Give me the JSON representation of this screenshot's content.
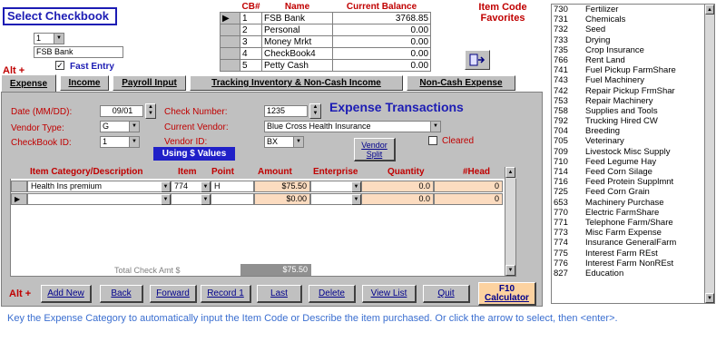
{
  "header": {
    "title": "Select Checkbook",
    "selected_number": "1",
    "selected_name": "FSB Bank",
    "fast_entry_label": "Fast Entry",
    "alt_label": "Alt +"
  },
  "cb_table": {
    "columns": [
      "CB#",
      "Name",
      "Current Balance"
    ],
    "rows": [
      {
        "num": "1",
        "name": "FSB Bank",
        "balance": "3768.85"
      },
      {
        "num": "2",
        "name": "Personal",
        "balance": "0.00"
      },
      {
        "num": "3",
        "name": "Money Mrkt",
        "balance": "0.00"
      },
      {
        "num": "4",
        "name": "CheckBook4",
        "balance": "0.00"
      },
      {
        "num": "5",
        "name": "Petty Cash",
        "balance": "0.00"
      }
    ]
  },
  "favorites": {
    "title_line1": "Item Code",
    "title_line2": "Favorites"
  },
  "tabs": [
    "Expense",
    "Income",
    "Payroll Input",
    "Tracking Inventory & Non-Cash Income",
    "Non-Cash Expense"
  ],
  "form": {
    "section_title": "Expense Transactions",
    "date_label": "Date (MM/DD):",
    "date_value": "09/01",
    "vendor_type_label": "Vendor Type:",
    "vendor_type_value": "G",
    "checkbook_id_label": "CheckBook ID:",
    "checkbook_id_value": "1",
    "check_number_label": "Check Number:",
    "check_number_value": "1235",
    "current_vendor_label": "Current Vendor:",
    "current_vendor_value": "Blue Cross Health Insurance",
    "vendor_id_label": "Vendor ID:",
    "vendor_id_value": "BX",
    "using_values_label": "Using $ Values",
    "vendor_split_label": "Vendor Split",
    "cleared_label": "Cleared"
  },
  "grid": {
    "columns": [
      "Item Category/Description",
      "Item",
      "Point",
      "Amount",
      "Enterprise",
      "Quantity",
      "#Head"
    ],
    "rows": [
      {
        "desc": "Health Ins premium",
        "item": "774",
        "point": "H",
        "amount": "$75.50",
        "enterprise": "",
        "quantity": "0.0",
        "head": "0"
      },
      {
        "desc": "",
        "item": "",
        "point": "",
        "amount": "$0.00",
        "enterprise": "",
        "quantity": "0.0",
        "head": "0"
      }
    ],
    "total_label": "Total Check Amt $",
    "total_value": "$75.50"
  },
  "footer": {
    "alt_label": "Alt +",
    "buttons": [
      "Add New",
      "Back",
      "Forward",
      "Record 1",
      "Last",
      "Delete",
      "View List",
      "Quit"
    ],
    "f10_label": "F10",
    "calculator_label": "Calculator"
  },
  "categories": [
    {
      "code": "730",
      "name": "Fertilizer"
    },
    {
      "code": "731",
      "name": "Chemicals"
    },
    {
      "code": "732",
      "name": "Seed"
    },
    {
      "code": "733",
      "name": "Drying"
    },
    {
      "code": "735",
      "name": "Crop Insurance"
    },
    {
      "code": "766",
      "name": "Rent Land"
    },
    {
      "code": "741",
      "name": "Fuel Pickup FarmShare"
    },
    {
      "code": "743",
      "name": "Fuel Machinery"
    },
    {
      "code": "742",
      "name": "Repair Pickup FrmShar"
    },
    {
      "code": "753",
      "name": "Repair Machinery"
    },
    {
      "code": "758",
      "name": "Supplies and Tools"
    },
    {
      "code": "792",
      "name": "Trucking Hired CW"
    },
    {
      "code": "704",
      "name": "Breeding"
    },
    {
      "code": "705",
      "name": "Veterinary"
    },
    {
      "code": "709",
      "name": "Livestock Misc Supply"
    },
    {
      "code": "710",
      "name": "Feed Legume Hay"
    },
    {
      "code": "714",
      "name": "Feed Corn Silage"
    },
    {
      "code": "716",
      "name": "Feed Protein Supplmnt"
    },
    {
      "code": "725",
      "name": "Feed Corn Grain"
    },
    {
      "code": "653",
      "name": "Machinery Purchase"
    },
    {
      "code": "770",
      "name": "Electric FarmShare"
    },
    {
      "code": "771",
      "name": "Telephone Farm/Share"
    },
    {
      "code": "773",
      "name": "Misc Farm Expense"
    },
    {
      "code": "774",
      "name": "Insurance GeneralFarm"
    },
    {
      "code": "775",
      "name": "Interest Farm REst"
    },
    {
      "code": "776",
      "name": "Interest Farm NonREst"
    },
    {
      "code": "827",
      "name": "Education"
    }
  ],
  "status_text": "Key the Expense Category to automatically input the Item Code or Describe the item purchased. Or click the arrow to select, then <enter>.",
  "colors": {
    "accent_blue": "#1c1cb4",
    "label_red": "#c00000",
    "peach": "#fcdcc0",
    "panel_gray": "#c0c0c0"
  }
}
